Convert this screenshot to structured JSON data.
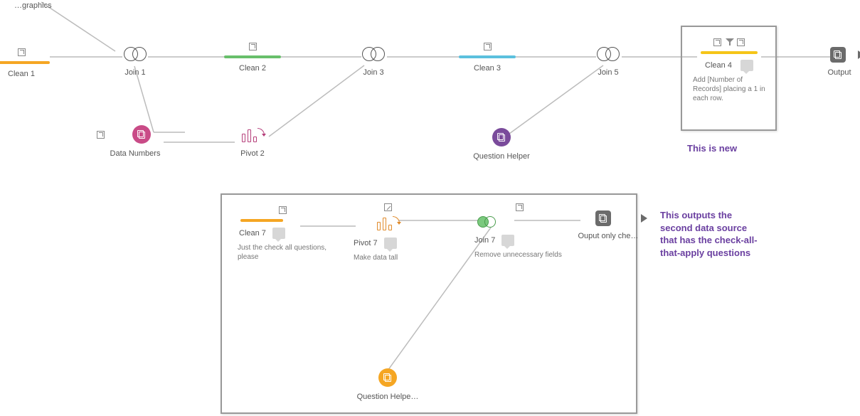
{
  "topEdge": {
    "partialLabel": "…graphics"
  },
  "nodes": {
    "clean1": {
      "label": "Clean 1"
    },
    "join1": {
      "label": "Join 1"
    },
    "clean2": {
      "label": "Clean 2"
    },
    "join3": {
      "label": "Join 3"
    },
    "clean3": {
      "label": "Clean 3"
    },
    "join5": {
      "label": "Join 5"
    },
    "clean4": {
      "label": "Clean 4",
      "desc": "Add [Number of Records] placing a 1 in each row."
    },
    "output": {
      "label": "Output"
    },
    "dataNumbers": {
      "label": "Data Numbers"
    },
    "pivot2": {
      "label": "Pivot 2"
    },
    "questionHelper": {
      "label": "Question Helper"
    },
    "clean7": {
      "label": "Clean 7",
      "desc": "Just the check all questions, please"
    },
    "pivot7": {
      "label": "Pivot 7",
      "desc": "Make data tall"
    },
    "join7": {
      "label": "Join 7",
      "desc": "Remove unnecessary fields"
    },
    "outputOnly": {
      "label": "Ouput only che…"
    },
    "questionHelper2": {
      "label": "Question Helpe…"
    }
  },
  "annotations": {
    "new": "This is new",
    "second": "This outputs the second data source that has the check-all-that-apply questions"
  }
}
